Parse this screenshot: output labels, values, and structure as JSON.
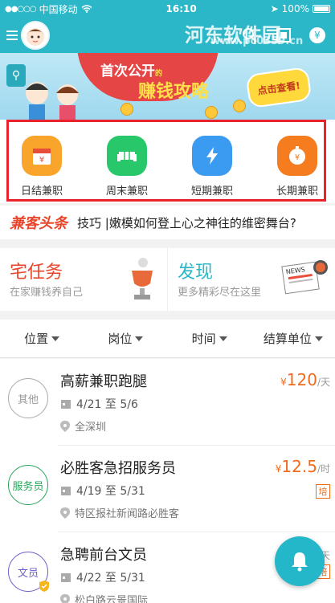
{
  "status_bar": {
    "carrier": "中国移动",
    "time": "16:10",
    "battery": "100%"
  },
  "watermark": {
    "text": "河东软件园",
    "url": "www.pc0359.cn"
  },
  "banner": {
    "headline": "首次公开",
    "headline_small": "的",
    "subtitle": "赚钱攻略",
    "cta": "点击查看!"
  },
  "categories": [
    {
      "label": "日结兼职",
      "icon": "calendar-yen-icon",
      "color": "#f9a52b"
    },
    {
      "label": "周末兼职",
      "icon": "sofa-icon",
      "color": "#27c76a"
    },
    {
      "label": "短期兼职",
      "icon": "lightning-icon",
      "color": "#3a9bf0"
    },
    {
      "label": "长期兼职",
      "icon": "stopwatch-yen-icon",
      "color": "#f57c1f"
    }
  ],
  "ticker": {
    "brand": "兼客头条",
    "text": "技巧 |嫩模如何登上心之神往的维密舞台?"
  },
  "promos": [
    {
      "title": "宅任务",
      "subtitle": "在家赚钱养自己",
      "color": "#e8462b"
    },
    {
      "title": "发现",
      "subtitle": "更多精彩尽在这里",
      "color": "#2bb7c7"
    }
  ],
  "filters": [
    "位置",
    "岗位",
    "时间",
    "结算单位"
  ],
  "jobs": [
    {
      "tag": "其他",
      "tag_color": "#aaaaaa",
      "title": "高薪兼职跑腿",
      "date": "4/21 至 5/6",
      "location": "全深圳",
      "currency": "¥",
      "pay": "120",
      "unit": "/天",
      "badge": ""
    },
    {
      "tag": "服务员",
      "tag_color": "#27a55a",
      "title": "必胜客急招服务员",
      "date": "4/19 至 5/31",
      "location": "特区报社新闻路必胜客",
      "currency": "¥",
      "pay": "12.5",
      "unit": "/时",
      "badge": "培"
    },
    {
      "tag": "文员",
      "tag_color": "#6b5fc9",
      "title": "急聘前台文员",
      "date": "4/22 至 5/31",
      "location": "松白路云景国际",
      "currency": "",
      "pay": "",
      "unit": "天",
      "badge": "培"
    }
  ]
}
